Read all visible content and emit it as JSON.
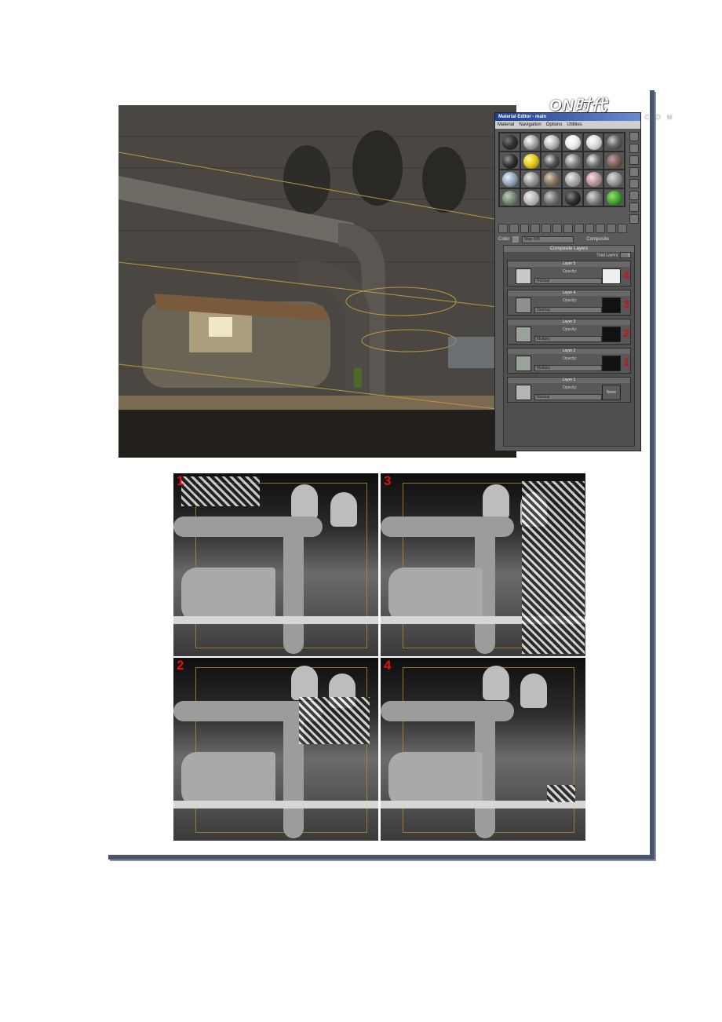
{
  "watermark": {
    "logo_text": "ON时代",
    "url": "W W W . N X S . C O M"
  },
  "material_editor": {
    "title": "Material Editor - main",
    "menu": [
      "Material",
      "Navigation",
      "Options",
      "Utilities"
    ],
    "color_label": "Color",
    "map_field": "Map #28",
    "composite_label": "Composite",
    "panel_title": "Composite Layers",
    "total_layers_label": "Total Layers:",
    "total_layers_value": "5",
    "opacity_label": "Opacity:",
    "layers": [
      {
        "name": "Layer 5",
        "blend": "Normal",
        "mask": "",
        "marker": "4"
      },
      {
        "name": "Layer 4",
        "blend": "Overlay",
        "mask": "",
        "marker": "3"
      },
      {
        "name": "Layer 3",
        "blend": "Multiply",
        "mask": "",
        "marker": "2"
      },
      {
        "name": "Layer 2",
        "blend": "Multiply",
        "mask": "",
        "marker": "1"
      },
      {
        "name": "Layer 1",
        "blend": "Normal",
        "mask": "None",
        "marker": ""
      }
    ]
  },
  "viewports": [
    {
      "label": "1"
    },
    {
      "label": "3"
    },
    {
      "label": "2"
    },
    {
      "label": "4"
    }
  ],
  "colors": {
    "marker_red": "#e01010",
    "frame_blue": "#4a556b",
    "title_blue": "#1f3e8f"
  }
}
